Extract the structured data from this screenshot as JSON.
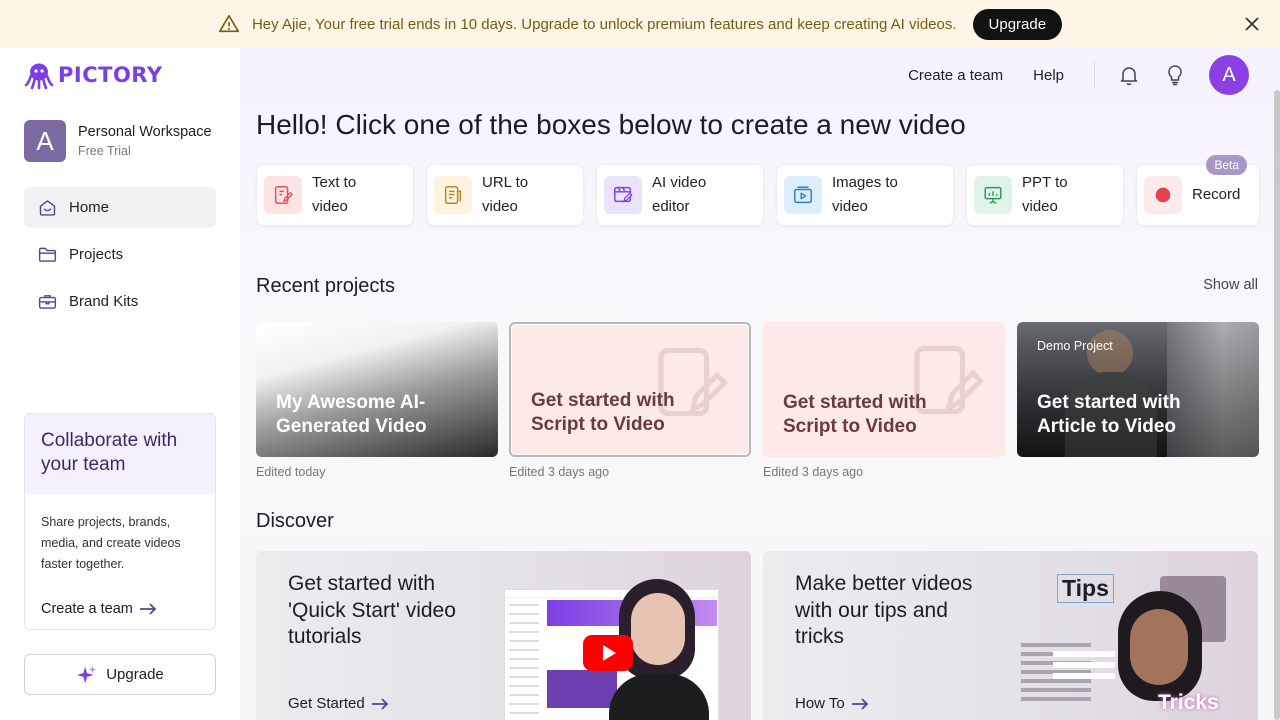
{
  "banner": {
    "message": "Hey Ajie, Your free trial ends in 10 days. Upgrade to unlock premium features and keep creating AI videos.",
    "button": "Upgrade"
  },
  "logo": {
    "text": "PICTORY"
  },
  "workspace": {
    "avatar": "A",
    "name": "Personal Workspace",
    "plan": "Free Trial"
  },
  "nav": [
    {
      "label": "Home",
      "icon": "home-icon",
      "active": true
    },
    {
      "label": "Projects",
      "icon": "folder-icon"
    },
    {
      "label": "Brand Kits",
      "icon": "briefcase-icon"
    }
  ],
  "collab": {
    "title": "Collaborate with your team",
    "body": "Share projects, brands, media, and create videos faster together.",
    "link": "Create a team"
  },
  "sidebar_upgrade": "Upgrade",
  "topbar": {
    "create_team": "Create a team",
    "help": "Help",
    "avatar": "A"
  },
  "greeting": "Hello! Click one of the boxes below to create a new video",
  "tiles": [
    {
      "label": "Text to video",
      "icon": "text-to-video-icon",
      "color": "#fde3e3"
    },
    {
      "label": "URL to video",
      "icon": "url-to-video-icon",
      "color": "#fdf3df"
    },
    {
      "label": "AI video editor",
      "icon": "video-editor-icon",
      "color": "#ebe2fb"
    },
    {
      "label": "Images to video",
      "icon": "images-to-video-icon",
      "color": "#ddeefb"
    },
    {
      "label": "PPT to video",
      "icon": "ppt-to-video-icon",
      "color": "#e0f4e7"
    },
    {
      "label": "Record",
      "icon": "record-icon",
      "color": "#fdeaea",
      "badge": "Beta"
    }
  ],
  "recent": {
    "title": "Recent projects",
    "show_all": "Show all",
    "items": [
      {
        "title": "My Awesome AI-Generated Video",
        "edited": "Edited today"
      },
      {
        "title": "Get started with Script to Video",
        "edited": "Edited 3 days ago"
      },
      {
        "title": "Get started with Script to Video",
        "edited": "Edited 3 days ago"
      },
      {
        "title": "Get started with Article to Video",
        "tag": "Demo Project"
      }
    ]
  },
  "discover": {
    "title": "Discover",
    "cards": [
      {
        "title": "Get started with 'Quick Start' video tutorials",
        "link": "Get Started"
      },
      {
        "title": "Make better videos with our tips and tricks",
        "link": "How To",
        "art_tips": "Tips",
        "art_tricks": "Tricks"
      }
    ]
  }
}
